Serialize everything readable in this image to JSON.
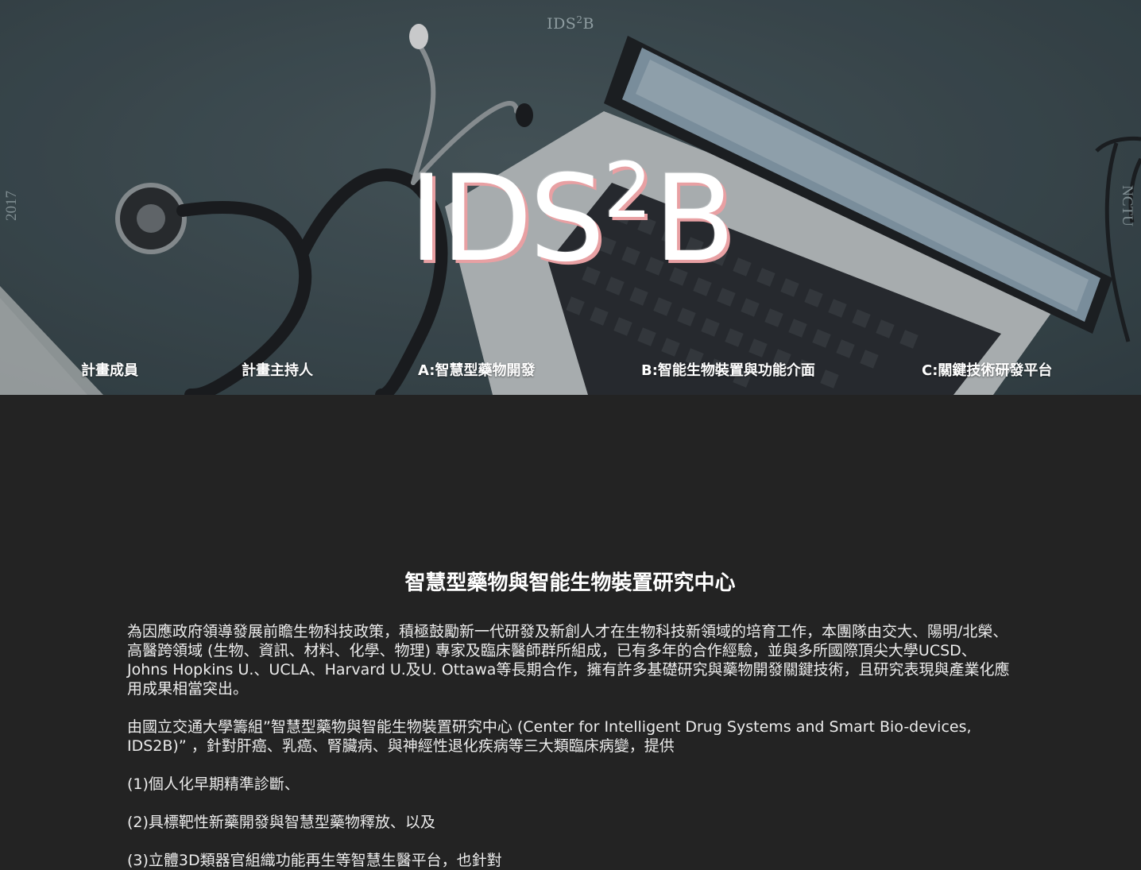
{
  "header": {
    "brand": "IDS",
    "brand_sup": "2",
    "brand_end": "B",
    "side_left": "2017",
    "side_right": "NCTU",
    "hero_title_main": "IDS",
    "hero_title_sup": "2",
    "hero_title_end": "B"
  },
  "nav": {
    "items": [
      {
        "label": "計畫成員"
      },
      {
        "label": "計畫主持人"
      },
      {
        "label": "A:智慧型藥物開發"
      },
      {
        "label": "B:智能生物裝置與功能介面"
      },
      {
        "label": "C:關鍵技術研發平台"
      }
    ]
  },
  "main": {
    "title": "智慧型藥物與智能生物裝置研究中心",
    "paragraphs": [
      "為因應政府領導發展前瞻生物科技政策，積極鼓勵新一代研發及新創人才在生物科技新領域的培育工作，本團隊由交大、陽明/北榮、高醫跨領域 (生物、資訊、材料、化學、物理) 專家及臨床醫師群所組成，已有多年的合作經驗，並與多所國際頂尖大學UCSD、Johns Hopkins U.、UCLA、Harvard U.及U. Ottawa等長期合作，擁有許多基礎研究與藥物開發關鍵技術，且研究表現與產業化應用成果相當突出。",
      "由國立交通大學籌組”智慧型藥物與智能生物裝置研究中心 (Center for Intelligent Drug Systems and Smart Bio-devices, IDS2B)” ，針對肝癌、乳癌、腎臟病、與神經性退化疾病等三大類臨床病變，提供",
      "(1)個人化早期精準診斷、",
      "(2)具標靶性新藥開發與智慧型藥物釋放、以及",
      "(3)立體3D類器官組織功能再生等智慧生醫平台，也針對"
    ]
  },
  "colors": {
    "background": "#232323",
    "hero_tint": "#3f4e53",
    "title_shadow": "#e8a0a3"
  },
  "icons": [
    "stethoscope-image",
    "laptop-image",
    "eyeglasses-image"
  ]
}
